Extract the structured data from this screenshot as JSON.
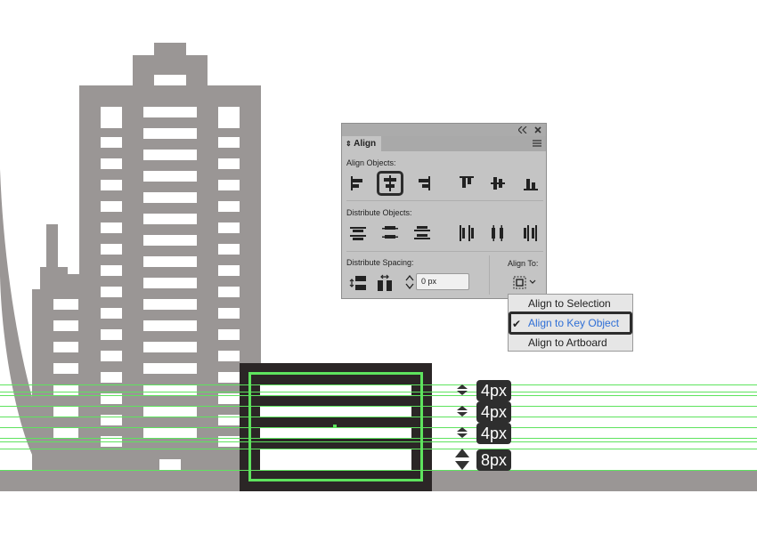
{
  "colors": {
    "building": "#9a9695",
    "ground": "#9a9695",
    "window": "#ffffff",
    "selection_bg": "#2b2626",
    "selection_outline": "#5ee35e",
    "guide": "#5ee35e",
    "badge_bg": "#2e2e2e",
    "panel_bg": "#c4c4c4",
    "highlight_blue": "#2f6fd6"
  },
  "panel": {
    "tab_label": "Align",
    "collapse_icon": "double-chevron-left-icon",
    "close_icon": "close-icon",
    "menu_icon": "panel-menu-icon",
    "align_objects_label": "Align Objects:",
    "distribute_objects_label": "Distribute Objects:",
    "distribute_spacing_label": "Distribute Spacing:",
    "align_to_label": "Align To:",
    "spacing_value": "0 px"
  },
  "dropdown": {
    "items": [
      "Align to Selection",
      "Align to Key Object",
      "Align to Artboard"
    ],
    "selected": "Align to Key Object"
  },
  "measurements": [
    "4px",
    "4px",
    "4px",
    "8px"
  ]
}
